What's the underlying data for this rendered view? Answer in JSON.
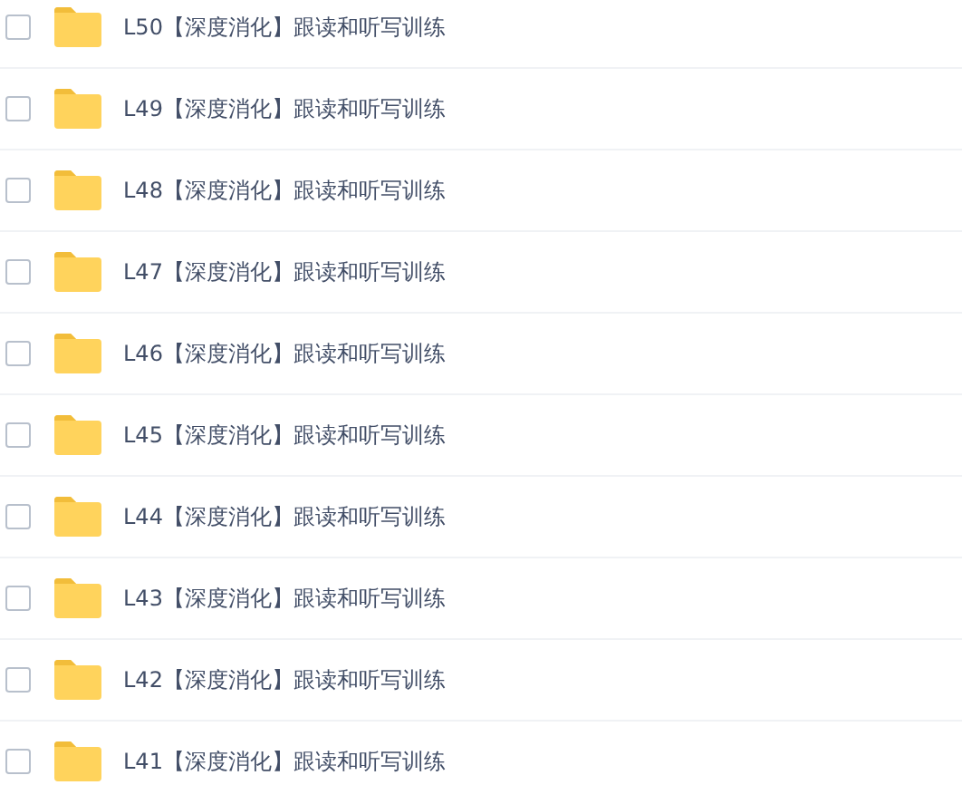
{
  "files": [
    {
      "name": "L50【深度消化】跟读和听写训练",
      "checked": false
    },
    {
      "name": "L49【深度消化】跟读和听写训练",
      "checked": false
    },
    {
      "name": "L48【深度消化】跟读和听写训练",
      "checked": false
    },
    {
      "name": "L47【深度消化】跟读和听写训练",
      "checked": false
    },
    {
      "name": "L46【深度消化】跟读和听写训练",
      "checked": false
    },
    {
      "name": "L45【深度消化】跟读和听写训练",
      "checked": false
    },
    {
      "name": "L44【深度消化】跟读和听写训练",
      "checked": false
    },
    {
      "name": "L43【深度消化】跟读和听写训练",
      "checked": false
    },
    {
      "name": "L42【深度消化】跟读和听写训练",
      "checked": false
    },
    {
      "name": "L41【深度消化】跟读和听写训练",
      "checked": false
    }
  ]
}
